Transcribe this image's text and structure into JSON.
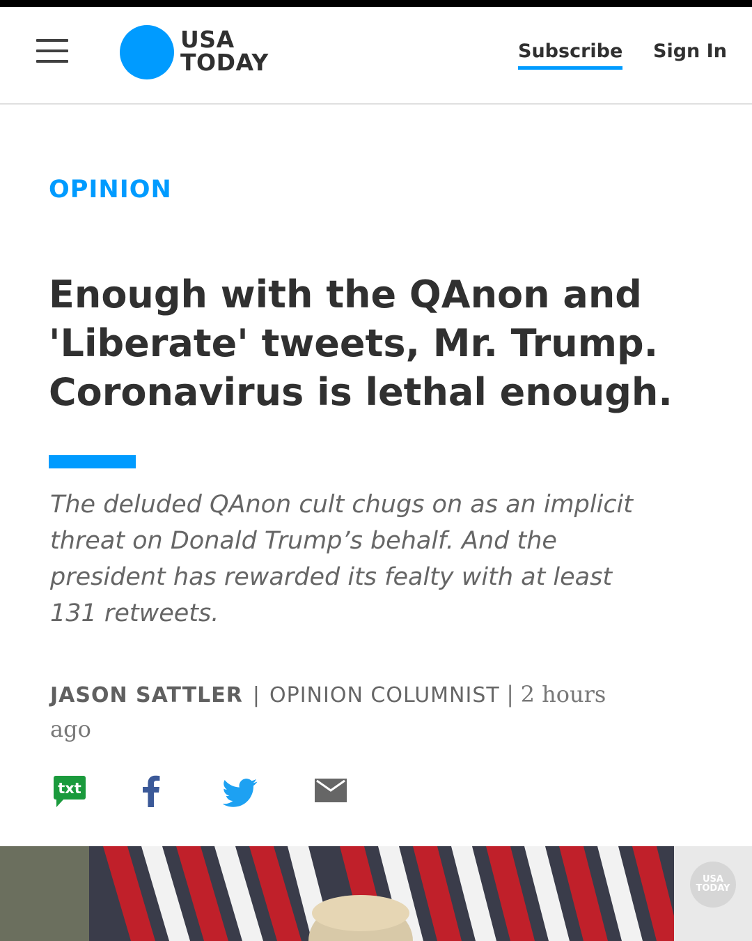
{
  "header": {
    "logo_line1": "USA",
    "logo_line2": "TODAY",
    "subscribe_label": "Subscribe",
    "signin_label": "Sign In",
    "brand_color": "#009bff"
  },
  "article": {
    "section": "OPINION",
    "headline_lines": [
      "Enough with the QAnon and",
      "'Liberate' tweets, Mr. Trump.",
      "Coronavirus is lethal enough."
    ],
    "dek_lines": [
      "The deluded QAnon cult chugs on as an implicit",
      "threat on Donald Trump’s behalf. And the",
      "president has rewarded its fealty with at least",
      "131 retweets."
    ],
    "author": "JASON SATTLER",
    "separator": "|",
    "role": "OPINION COLUMNIST",
    "time_separator": "|",
    "time_line1": "2 hours",
    "time_line2": "ago"
  },
  "share": {
    "txt_label": "txt",
    "icons": [
      "sms-icon",
      "facebook-icon",
      "twitter-icon",
      "email-icon"
    ]
  },
  "photo": {
    "watermark_line1": "USA",
    "watermark_line2": "TODAY"
  }
}
